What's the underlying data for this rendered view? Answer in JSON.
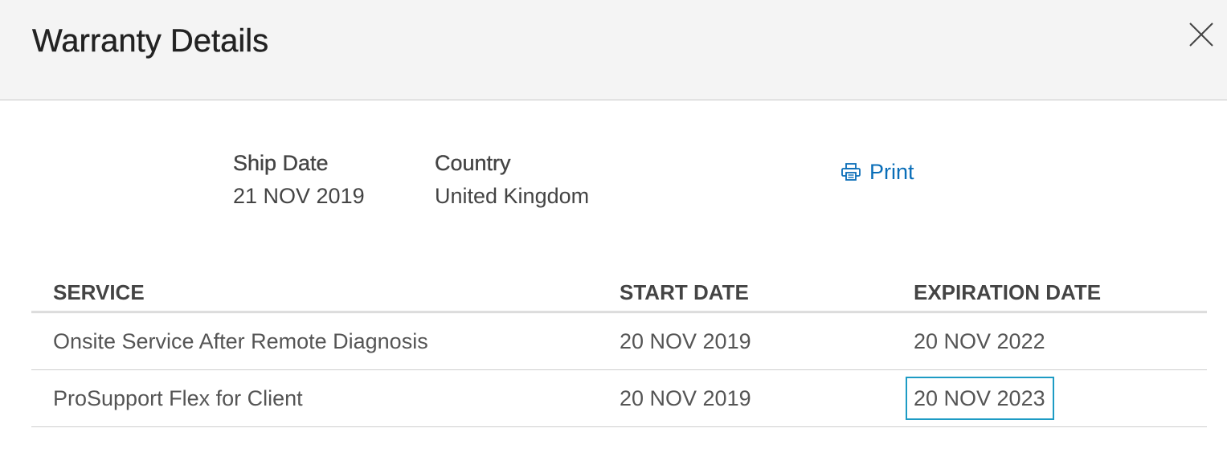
{
  "header": {
    "title": "Warranty Details",
    "close_icon": "close-icon"
  },
  "info": {
    "ship_date_label": "Ship Date",
    "ship_date_value": "21 NOV 2019",
    "country_label": "Country",
    "country_value": "United Kingdom"
  },
  "print": {
    "label": "Print",
    "icon": "printer-icon",
    "color": "#0a6eb8"
  },
  "table": {
    "columns": [
      "SERVICE",
      "START DATE",
      "EXPIRATION DATE"
    ],
    "rows": [
      {
        "service": "Onsite Service After Remote Diagnosis",
        "start_date": "20 NOV 2019",
        "expiration_date": "20 NOV 2022"
      },
      {
        "service": "ProSupport Flex for Client",
        "start_date": "20 NOV 2019",
        "expiration_date": "20 NOV 2023"
      }
    ],
    "highlight_color": "#1d9bc4"
  }
}
